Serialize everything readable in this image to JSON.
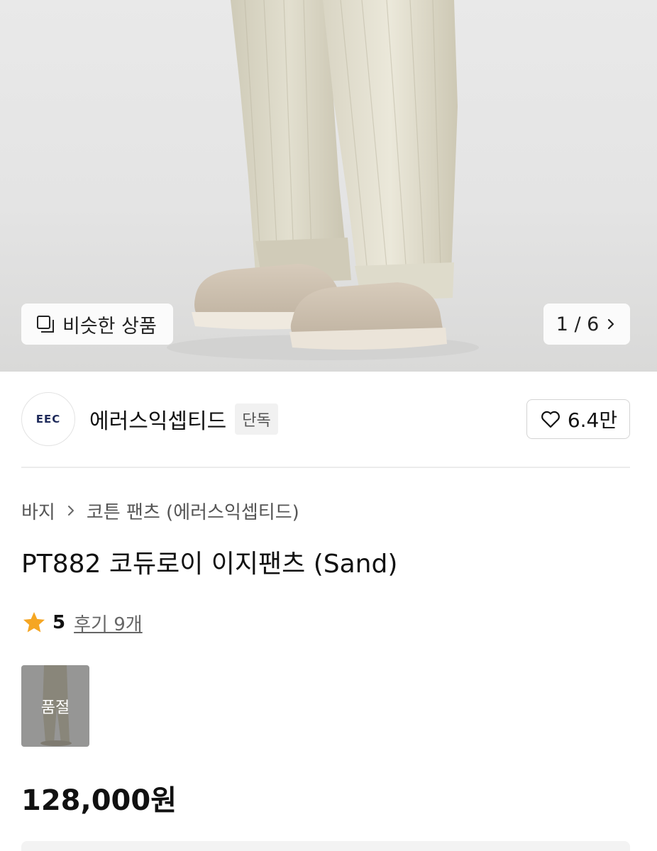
{
  "gallery": {
    "similar_label": "비슷한 상품",
    "page_indicator": "1 / 6"
  },
  "brand": {
    "logo_text": "EEC",
    "name": "에러스익셉티드",
    "badge": "단독",
    "likes": "6.4만"
  },
  "breadcrumb": {
    "category": "바지",
    "subcategory": "코튼 팬츠 (에러스익셉티드)"
  },
  "product": {
    "title": "PT882 코듀로이 이지팬츠 (Sand)",
    "rating": "5",
    "reviews_label": "후기 9개",
    "price": "128,000원"
  },
  "variants": [
    {
      "status": "품절"
    }
  ],
  "colors": {
    "star": "#F5A623",
    "logo": "#1E2A5A"
  }
}
